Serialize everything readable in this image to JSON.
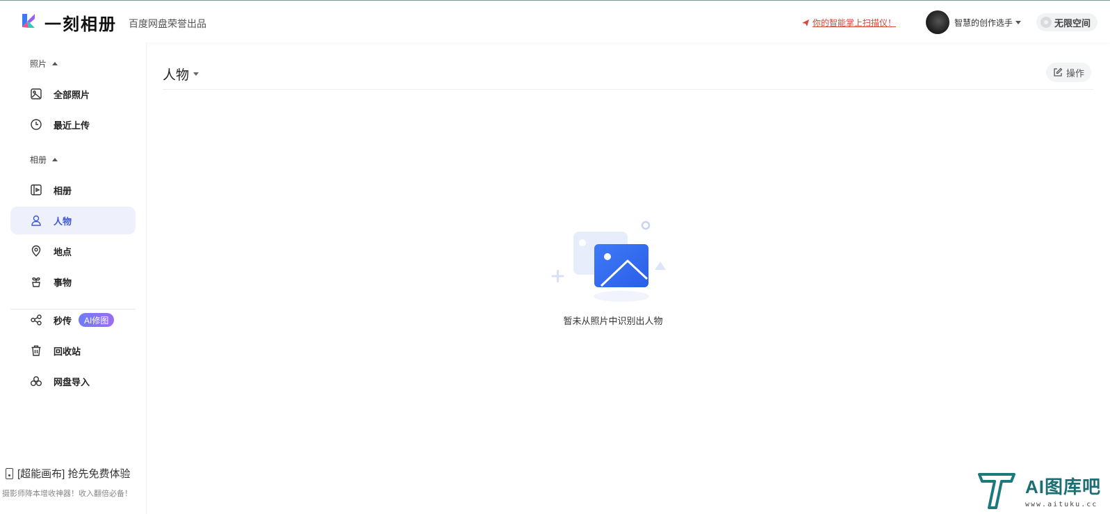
{
  "header": {
    "brand": "一刻相册",
    "brand_sub": "百度网盘荣誉出品",
    "promo": "你的智能掌上扫描仪！",
    "username": "智慧的创作选手",
    "space_label": "无限空间"
  },
  "sidebar": {
    "photos_section": "照片",
    "albums_section": "相册",
    "items": [
      {
        "label": "全部照片",
        "icon": "image-icon"
      },
      {
        "label": "最近上传",
        "icon": "clock-icon"
      },
      {
        "label": "相册",
        "icon": "album-icon"
      },
      {
        "label": "人物",
        "icon": "person-icon",
        "active": true
      },
      {
        "label": "地点",
        "icon": "location-icon"
      },
      {
        "label": "事物",
        "icon": "plant-icon"
      },
      {
        "label": "秒传",
        "icon": "share-icon",
        "badge": "AI修图"
      },
      {
        "label": "回收站",
        "icon": "trash-icon"
      },
      {
        "label": "网盘导入",
        "icon": "cloud-icon"
      }
    ],
    "promo_line1": "[超能画布] 抢先免费体验",
    "promo_line2": "摄影师降本增收神器！收入翻倍必备！"
  },
  "main": {
    "title": "人物",
    "operate_label": "操作",
    "empty_text": "暂未从照片中识别出人物"
  },
  "watermark": {
    "text": "AI图库吧",
    "url": "www.aituku.cc"
  },
  "colors": {
    "accent": "#3b57d6",
    "active_bg": "#eef1fc",
    "promo_red": "#d9443a"
  }
}
